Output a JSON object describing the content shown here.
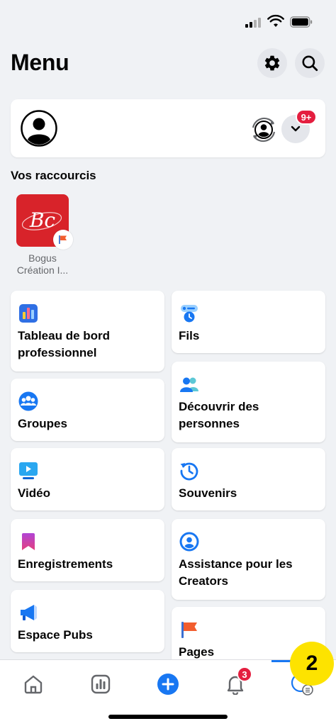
{
  "header": {
    "title": "Menu"
  },
  "profile": {
    "notification_count": "9+"
  },
  "shortcuts": {
    "section_title": "Vos raccourcis",
    "items": [
      {
        "label": "Bogus Création I...",
        "logo_text": "Bc"
      }
    ]
  },
  "tiles": {
    "left": [
      {
        "label": "Tableau de bord professionnel",
        "icon": "dashboard-icon"
      },
      {
        "label": "Groupes",
        "icon": "groups-icon"
      },
      {
        "label": "Vidéo",
        "icon": "video-icon"
      },
      {
        "label": "Enregistrements",
        "icon": "bookmark-icon"
      },
      {
        "label": "Espace Pubs",
        "icon": "megaphone-icon"
      }
    ],
    "right": [
      {
        "label": "Fils",
        "icon": "feeds-icon"
      },
      {
        "label": "Découvrir des personnes",
        "icon": "people-icon"
      },
      {
        "label": "Souvenirs",
        "icon": "memories-icon"
      },
      {
        "label": "Assistance pour les Creators",
        "icon": "creator-support-icon"
      },
      {
        "label": "Pages",
        "icon": "pages-flag-icon"
      }
    ]
  },
  "bottom_nav": {
    "items": [
      "home-icon",
      "dashboard-nav-icon",
      "create-icon",
      "notifications-icon",
      "menu-icon"
    ],
    "notifications_count": "3",
    "step_badge": "2"
  },
  "colors": {
    "accent": "#1877f2",
    "badge_red": "#e41e3f",
    "step_yellow": "#fde300",
    "background": "#f0f2f5"
  }
}
